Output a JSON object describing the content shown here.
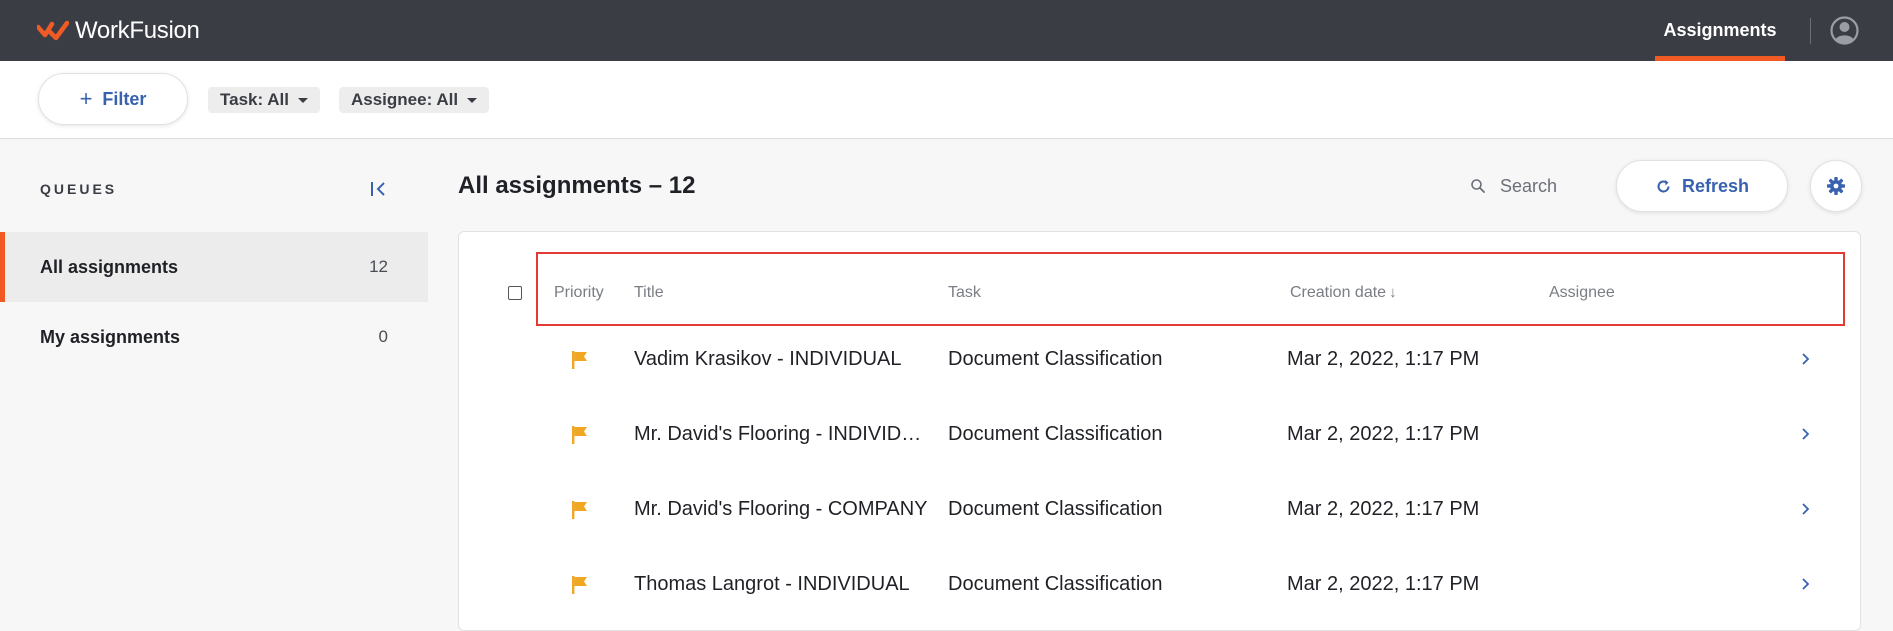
{
  "app": {
    "brand": "WorkFusion",
    "nav_active": "Assignments",
    "accent_color": "#f15a24",
    "link_color": "#3862b0"
  },
  "filterbar": {
    "filter_label": "Filter",
    "task_chip": "Task: All",
    "assignee_chip": "Assignee: All"
  },
  "sidebar": {
    "heading": "QUEUES",
    "queues": [
      {
        "name": "All assignments",
        "count": "12"
      },
      {
        "name": "My assignments",
        "count": "0"
      }
    ]
  },
  "main": {
    "title": "All assignments – 12",
    "search_placeholder": "Search",
    "refresh_label": "Refresh",
    "columns": {
      "priority": "Priority",
      "title": "Title",
      "task": "Task",
      "creation_date": "Creation date",
      "assignee": "Assignee"
    },
    "rows": [
      {
        "title": "Vadim Krasikov - INDIVIDUAL",
        "task": "Document Classification",
        "date": "Mar 2, 2022, 1:17 PM",
        "assignee": ""
      },
      {
        "title": "Mr. David's Flooring - INDIVIDUAL",
        "task": "Document Classification",
        "date": "Mar 2, 2022, 1:17 PM",
        "assignee": ""
      },
      {
        "title": "Mr. David's Flooring - COMPANY",
        "task": "Document Classification",
        "date": "Mar 2, 2022, 1:17 PM",
        "assignee": ""
      },
      {
        "title": "Thomas Langrot - INDIVIDUAL",
        "task": "Document Classification",
        "date": "Mar 2, 2022, 1:17 PM",
        "assignee": ""
      }
    ]
  }
}
